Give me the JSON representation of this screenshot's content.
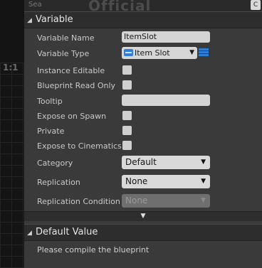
{
  "graph": {
    "zoom_label": "1:1"
  },
  "header_strip": {
    "search_text": "Sea",
    "watermark": "Official",
    "corner_glyph": "C"
  },
  "variable_section": {
    "title": "Variable",
    "fields": {
      "variable_name": {
        "label": "Variable Name",
        "value": "ItemSlot"
      },
      "variable_type": {
        "label": "Variable Type",
        "value": "Item Slot"
      },
      "instance_editable": {
        "label": "Instance Editable"
      },
      "blueprint_read_only": {
        "label": "Blueprint Read Only"
      },
      "tooltip": {
        "label": "Tooltip",
        "value": ""
      },
      "expose_on_spawn": {
        "label": "Expose on Spawn"
      },
      "private": {
        "label": "Private"
      },
      "expose_to_cinematics": {
        "label": "Expose to Cinematics"
      },
      "category": {
        "label": "Category",
        "value": "Default"
      },
      "replication": {
        "label": "Replication",
        "value": "None"
      },
      "replication_condition": {
        "label": "Replication Condition",
        "value": "None"
      }
    },
    "checkbox_states": {
      "instance_editable": false,
      "blueprint_read_only": false,
      "expose_on_spawn": false,
      "private": false,
      "expose_to_cinematics": false
    }
  },
  "advanced_toggle": {
    "glyph": "▼"
  },
  "default_value_section": {
    "title": "Default Value",
    "message": "Please compile the blueprint"
  },
  "colors": {
    "panel_bg": "#3a3a3a",
    "header_bg": "#2d2d2d",
    "type_pill": "#2f7fd6",
    "field_bg": "#d4d4d4"
  },
  "icons": {
    "section_caret": "triangle-down-icon",
    "type_pill": "struct-type-icon",
    "container_type": "array-type-icon",
    "dropdown_arrow": "chevron-down-icon"
  }
}
